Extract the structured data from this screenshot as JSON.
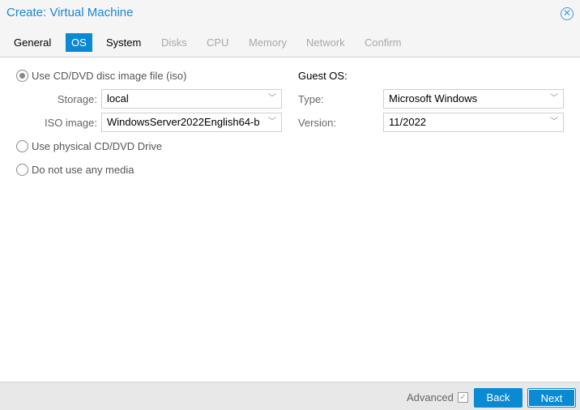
{
  "title": "Create: Virtual Machine",
  "tabs": [
    "General",
    "OS",
    "System",
    "Disks",
    "CPU",
    "Memory",
    "Network",
    "Confirm"
  ],
  "media": {
    "iso_label": "Use CD/DVD disc image file (iso)",
    "storage_label": "Storage:",
    "storage_value": "local",
    "iso_image_label": "ISO image:",
    "iso_image_value": "WindowsServer2022English64-b",
    "physical_label": "Use physical CD/DVD Drive",
    "none_label": "Do not use any media"
  },
  "guest": {
    "heading": "Guest OS:",
    "type_label": "Type:",
    "type_value": "Microsoft Windows",
    "version_label": "Version:",
    "version_value": "11/2022"
  },
  "footer": {
    "advanced": "Advanced",
    "back": "Back",
    "next": "Next"
  }
}
